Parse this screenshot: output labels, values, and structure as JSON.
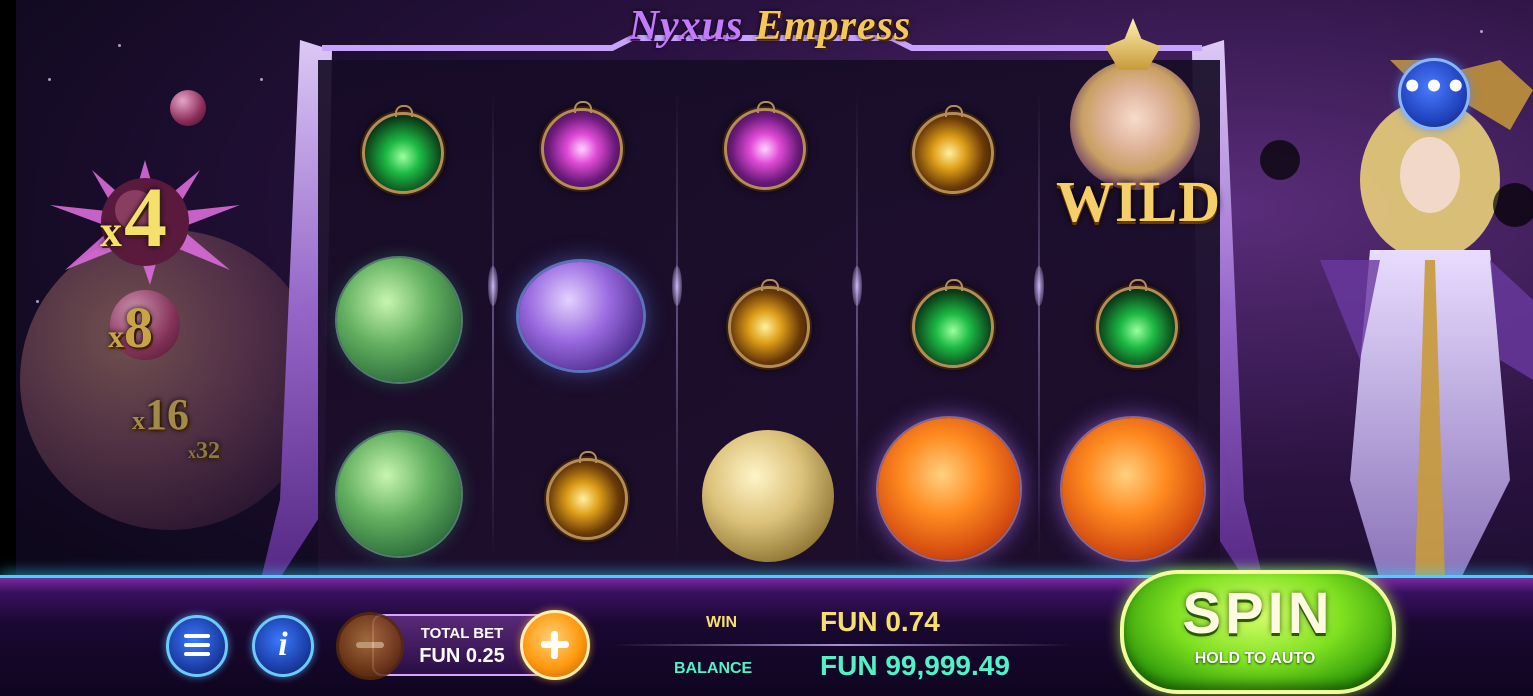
{
  "game": {
    "title_part1": "Nyxus",
    "title_part2": "Empress"
  },
  "multipliers": {
    "active": {
      "prefix": "x",
      "value": "4"
    },
    "next": [
      {
        "prefix": "x",
        "value": "8"
      },
      {
        "prefix": "x",
        "value": "16"
      },
      {
        "prefix": "x",
        "value": "32"
      }
    ]
  },
  "reels": {
    "columns": 5,
    "rows": 3,
    "symbols": [
      [
        "green-orb",
        "purple-orb",
        "purple-orb",
        "gold-orb",
        "wild"
      ],
      [
        "green-planet",
        "purple-planet",
        "gold-orb",
        "green-orb",
        "green-orb"
      ],
      [
        "green-planet",
        "gold-orb",
        "gold-planet",
        "orange-planet",
        "orange-planet"
      ]
    ],
    "wild_label": "WILD"
  },
  "controls": {
    "menu_icon": "more-dots-icon",
    "menu_glyph": "•••",
    "info_glyph": "i",
    "total_bet_label": "TOTAL BET",
    "total_bet_value": "FUN 0.25",
    "win_label": "WIN",
    "win_value": "FUN 0.74",
    "balance_label": "BALANCE",
    "balance_value": "FUN 99,999.49",
    "spin_label": "SPIN",
    "spin_sub_label": "HOLD TO AUTO"
  },
  "colors": {
    "accent_gold": "#f5e06b",
    "accent_teal": "#4ff3c6",
    "bar_glow": "#3ad6ff",
    "spin_green": "#7ee020"
  }
}
